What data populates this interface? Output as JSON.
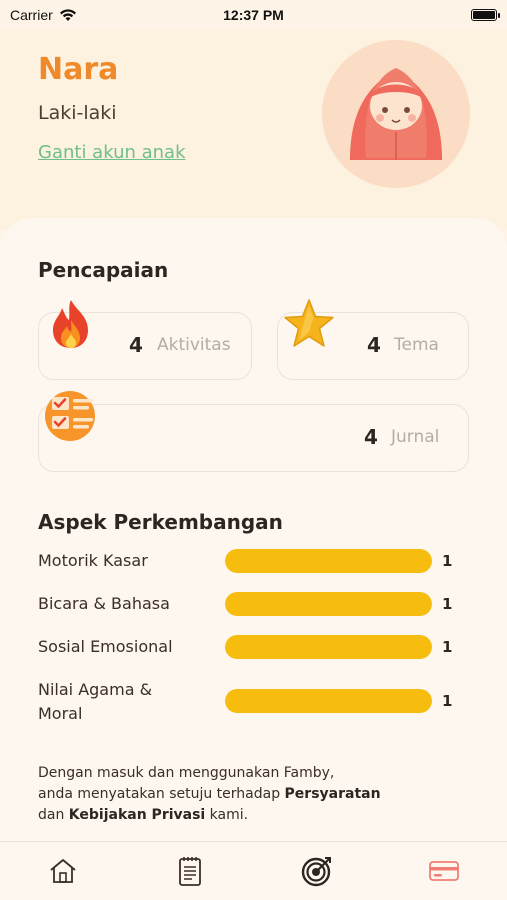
{
  "status_bar": {
    "carrier": "Carrier",
    "time": "12:37 PM"
  },
  "profile": {
    "name": "Nara",
    "gender": "Laki-laki",
    "switch_account": "Ganti akun anak"
  },
  "achievements": {
    "title": "Pencapaian",
    "items": [
      {
        "value": "4",
        "label": "Aktivitas",
        "icon": "fire-icon"
      },
      {
        "value": "4",
        "label": "Tema",
        "icon": "star-icon"
      },
      {
        "value": "4",
        "label": "Jurnal",
        "icon": "checklist-icon"
      }
    ]
  },
  "aspects": {
    "title": "Aspek Perkembangan",
    "items": [
      {
        "label": "Motorik Kasar",
        "value": "1",
        "level": 1.0
      },
      {
        "label": "Bicara & Bahasa",
        "value": "1",
        "level": 1.0
      },
      {
        "label": "Sosial Emosional",
        "value": "1",
        "level": 1.0
      },
      {
        "label": "Nilai Agama & Moral",
        "value": "1",
        "level": 1.0
      }
    ]
  },
  "disclaimer": {
    "line1": "Dengan masuk dan menggunakan Famby,",
    "line2_prefix": "anda menyatakan setuju terhadap ",
    "terms": "Persyaratan",
    "line3_prefix": "dan ",
    "privacy": "Kebijakan Privasi",
    "line3_suffix": " kami."
  },
  "tabs": [
    {
      "icon": "home-icon"
    },
    {
      "icon": "notebook-icon"
    },
    {
      "icon": "target-icon"
    },
    {
      "icon": "card-icon"
    }
  ],
  "colors": {
    "accent": "#f0892a",
    "link": "#6fbf86",
    "bar": "#f7bd0e",
    "card_icon": "#f07d74"
  }
}
